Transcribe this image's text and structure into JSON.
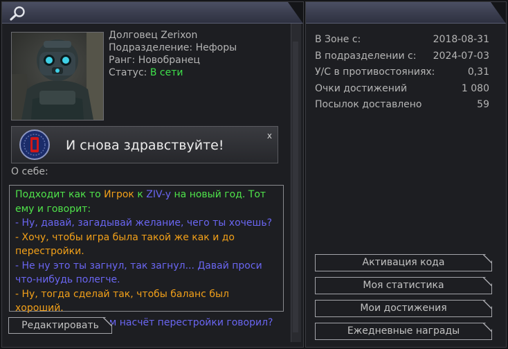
{
  "profile": {
    "name_line": "Долговец Zerixon",
    "division_line": "Подразделение: Нефоры",
    "rank_line": "Ранг: Новобранец",
    "status_label": "Статус:",
    "status_value": "В сети"
  },
  "banner": {
    "text": "И снова здравствуйте!",
    "close": "x"
  },
  "about": {
    "label": "О себе:",
    "lines": [
      {
        "segments": [
          {
            "text": "Подходит как то ",
            "color": "green"
          },
          {
            "text": "Игрок",
            "color": "orange"
          },
          {
            "text": " к ",
            "color": "green"
          },
          {
            "text": "ZIV-у",
            "color": "blue"
          },
          {
            "text": " на новый год. Тот",
            "color": "green"
          }
        ]
      },
      {
        "segments": [
          {
            "text": "ему и говорит:",
            "color": "green"
          }
        ]
      },
      {
        "segments": [
          {
            "text": "- Ну, давай, загадывай желание, чего ты хочешь?",
            "color": "blue"
          }
        ]
      },
      {
        "segments": [
          {
            "text": "- Хочу, чтобы игра была такой же как и до",
            "color": "orange"
          }
        ]
      },
      {
        "segments": [
          {
            "text": "перестройки.",
            "color": "orange"
          }
        ]
      },
      {
        "segments": [
          {
            "text": "- Не ну это ты загнул, так загнул... Давай проси",
            "color": "blue"
          }
        ]
      },
      {
        "segments": [
          {
            "text": "что-нибудь полегче.",
            "color": "blue"
          }
        ]
      },
      {
        "segments": [
          {
            "text": "- Ну, тогда сделай так, чтобы баланс был хороший.",
            "color": "orange"
          }
        ]
      },
      {
        "segments": [
          {
            "text": "- Так... а что ты там насчёт перестройки говорил?",
            "color": "blue"
          }
        ]
      }
    ]
  },
  "buttons": {
    "edit": "Редактировать",
    "activate_code": "Активация кода",
    "my_stats": "Моя статистика",
    "my_achievements": "Мои достижения",
    "daily_rewards": "Ежедневные награды"
  },
  "stats": [
    {
      "label": "В Зоне с:",
      "value": "2018-08-31"
    },
    {
      "label": "В подразделении с:",
      "value": "2024-07-03"
    },
    {
      "label": "У/С в противостояниях:",
      "value": "0,31"
    },
    {
      "label": "Очки достижений",
      "value": "1 080"
    },
    {
      "label": "Посылок доставлено",
      "value": "59"
    }
  ],
  "colors": {
    "green": "#4fe34a",
    "orange": "#f2a019",
    "blue": "#6a66f2",
    "online": "#3ee04a"
  },
  "icons": {
    "search": "search-icon",
    "badge": "faction-badge-icon"
  }
}
